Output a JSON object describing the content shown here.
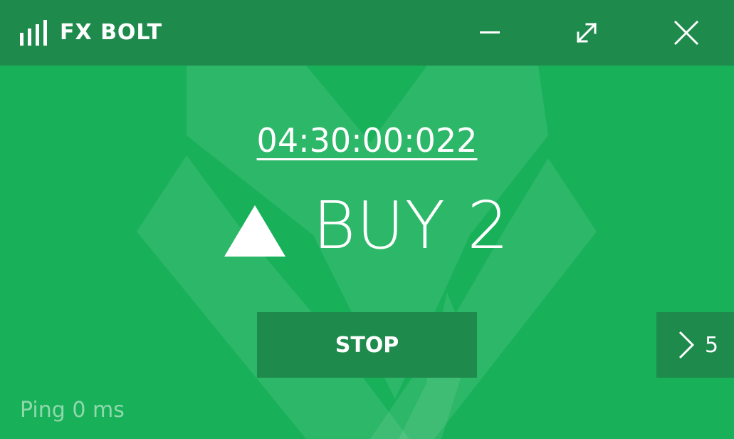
{
  "app": {
    "title": "FX BOLT"
  },
  "window_controls": {
    "minimize_icon": "minimize-icon",
    "maximize_icon": "maximize-icon",
    "close_icon": "close-icon"
  },
  "timer": {
    "value": "04:30:00:022"
  },
  "signal": {
    "direction_icon": "up-triangle-icon",
    "label": "BUY 2"
  },
  "actions": {
    "stop_label": "STOP",
    "next_icon": "chevron-right-icon",
    "next_count": "5"
  },
  "status": {
    "ping": "Ping 0 ms"
  },
  "colors": {
    "background": "#19b05a",
    "titlebar": "#1e8b4d",
    "button": "#1e8b4d",
    "text": "#ffffff",
    "muted_text": "#8fd9ac"
  }
}
